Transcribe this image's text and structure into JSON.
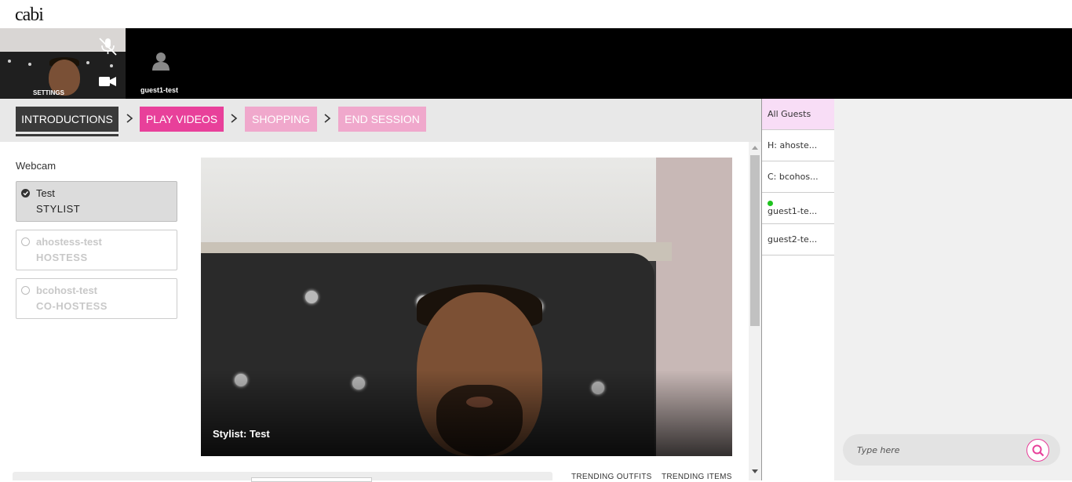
{
  "app": {
    "logo": "cabi"
  },
  "video_strip": {
    "self_tile": {
      "label": "SETTINGS",
      "mic_icon": "mic-off-icon",
      "camera_icon": "video-camera-icon"
    },
    "guests": [
      {
        "name": "guest1-test",
        "icon": "user-avatar-icon"
      }
    ]
  },
  "steps": [
    {
      "label": "INTRODUCTIONS",
      "state": "active"
    },
    {
      "label": "PLAY VIDEOS",
      "state": "current"
    },
    {
      "label": "SHOPPING",
      "state": "disabled"
    },
    {
      "label": "END SESSION",
      "state": "disabled"
    }
  ],
  "webcam": {
    "title": "Webcam",
    "options": [
      {
        "name": "Test",
        "role": "STYLIST",
        "selected": true
      },
      {
        "name": "ahostess-test",
        "role": "HOSTESS",
        "selected": false
      },
      {
        "name": "bcohost-test",
        "role": "CO-HOSTESS",
        "selected": false
      }
    ]
  },
  "main_video": {
    "caption": "Stylist: Test"
  },
  "bottom_tabs": {
    "trending_outfits": "TRENDING OUTFITS",
    "trending_items": "TRENDING ITEMS"
  },
  "guest_list": {
    "items": [
      {
        "label": "All Guests",
        "active": true,
        "online": false
      },
      {
        "label": "H: ahoste...",
        "active": false,
        "online": false
      },
      {
        "label": "C: bcohos...",
        "active": false,
        "online": false
      },
      {
        "label": "guest1-te...",
        "active": false,
        "online": true
      },
      {
        "label": "guest2-te...",
        "active": false,
        "online": false
      }
    ]
  },
  "chat": {
    "placeholder": "Type here",
    "search_icon": "search-icon"
  },
  "colors": {
    "accent": "#e8409a",
    "accent_faded": "#f0a8cc",
    "active_step": "#3a3a3a",
    "online": "#1ec31e"
  }
}
